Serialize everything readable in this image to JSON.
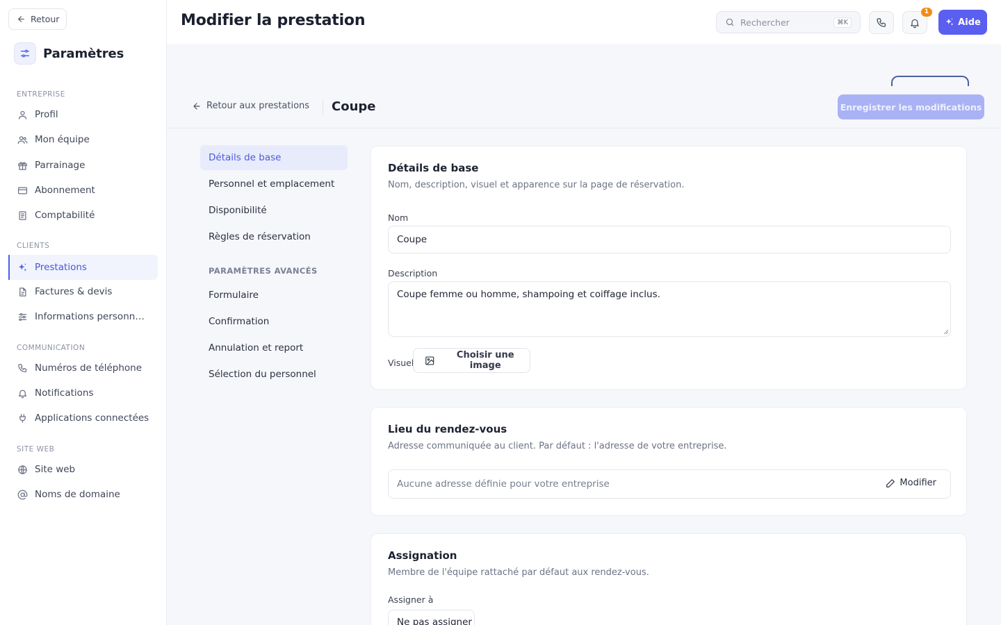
{
  "sidebar": {
    "back_label": "Retour",
    "title": "Paramètres",
    "sections": [
      {
        "label": "ENTREPRISE"
      },
      {
        "label": "CLIENTS"
      },
      {
        "label": "COMMUNICATION"
      },
      {
        "label": "SITE WEB"
      }
    ],
    "items": [
      {
        "label": "Profil",
        "icon": "user-icon"
      },
      {
        "label": "Mon équipe",
        "icon": "users-icon"
      },
      {
        "label": "Parrainage",
        "icon": "gift-icon"
      },
      {
        "label": "Abonnement",
        "icon": "credit-card-icon"
      },
      {
        "label": "Comptabilité",
        "icon": "receipt-icon"
      },
      {
        "label": "Prestations",
        "icon": "sparkles-icon",
        "active": true
      },
      {
        "label": "Factures & devis",
        "icon": "file-icon"
      },
      {
        "label": "Informations personnalis…",
        "icon": "sliders-icon"
      },
      {
        "label": "Numéros de téléphone",
        "icon": "phone-icon"
      },
      {
        "label": "Notifications",
        "icon": "bell-icon"
      },
      {
        "label": "Applications connectées",
        "icon": "plug-icon"
      },
      {
        "label": "Site web",
        "icon": "globe-icon"
      },
      {
        "label": "Noms de domaine",
        "icon": "at-icon"
      }
    ]
  },
  "topbar": {
    "title": "Modifier la prestation",
    "search_placeholder": "Rechercher",
    "search_shortcut": "⌘K",
    "notification_count": "1",
    "help_label": "Aide"
  },
  "subheader": {
    "back_label": "Retour aux prestations",
    "title": "Coupe",
    "save_label": "Enregistrer les modifications"
  },
  "section_nav": {
    "items": [
      {
        "label": "Détails de base",
        "active": true
      },
      {
        "label": "Personnel et emplacement"
      },
      {
        "label": "Disponibilité"
      },
      {
        "label": "Règles de réservation"
      }
    ],
    "advanced_label": "PARAMÈTRES AVANCÉS",
    "advanced_items": [
      {
        "label": "Formulaire"
      },
      {
        "label": "Confirmation"
      },
      {
        "label": "Annulation et report"
      },
      {
        "label": "Sélection du personnel"
      }
    ]
  },
  "details": {
    "title": "Détails de base",
    "subtitle": "Nom, description, visuel et apparence sur la page de réservation.",
    "name_label": "Nom",
    "name_value": "Coupe",
    "description_label": "Description",
    "description_value": "Coupe femme ou homme, shampoing et coiffage inclus.",
    "visual_label": "Visuel",
    "choose_image_label": "Choisir une image"
  },
  "location": {
    "title": "Lieu du rendez-vous",
    "subtitle": "Adresse communiquée au client. Par défaut : l'adresse de votre entreprise.",
    "address_value": "Aucune adresse définie pour votre entreprise",
    "edit_label": "Modifier"
  },
  "assignment": {
    "title": "Assignation",
    "subtitle": "Membre de l'équipe rattaché par défaut aux rendez-vous.",
    "assign_label": "Assigner à",
    "assign_value": "Ne pas assigner"
  },
  "colors": {
    "accent": "#5a5ff0",
    "accent_text": "#4657d6",
    "save_disabled": "#a9b2f4",
    "badge": "#f08c16"
  }
}
